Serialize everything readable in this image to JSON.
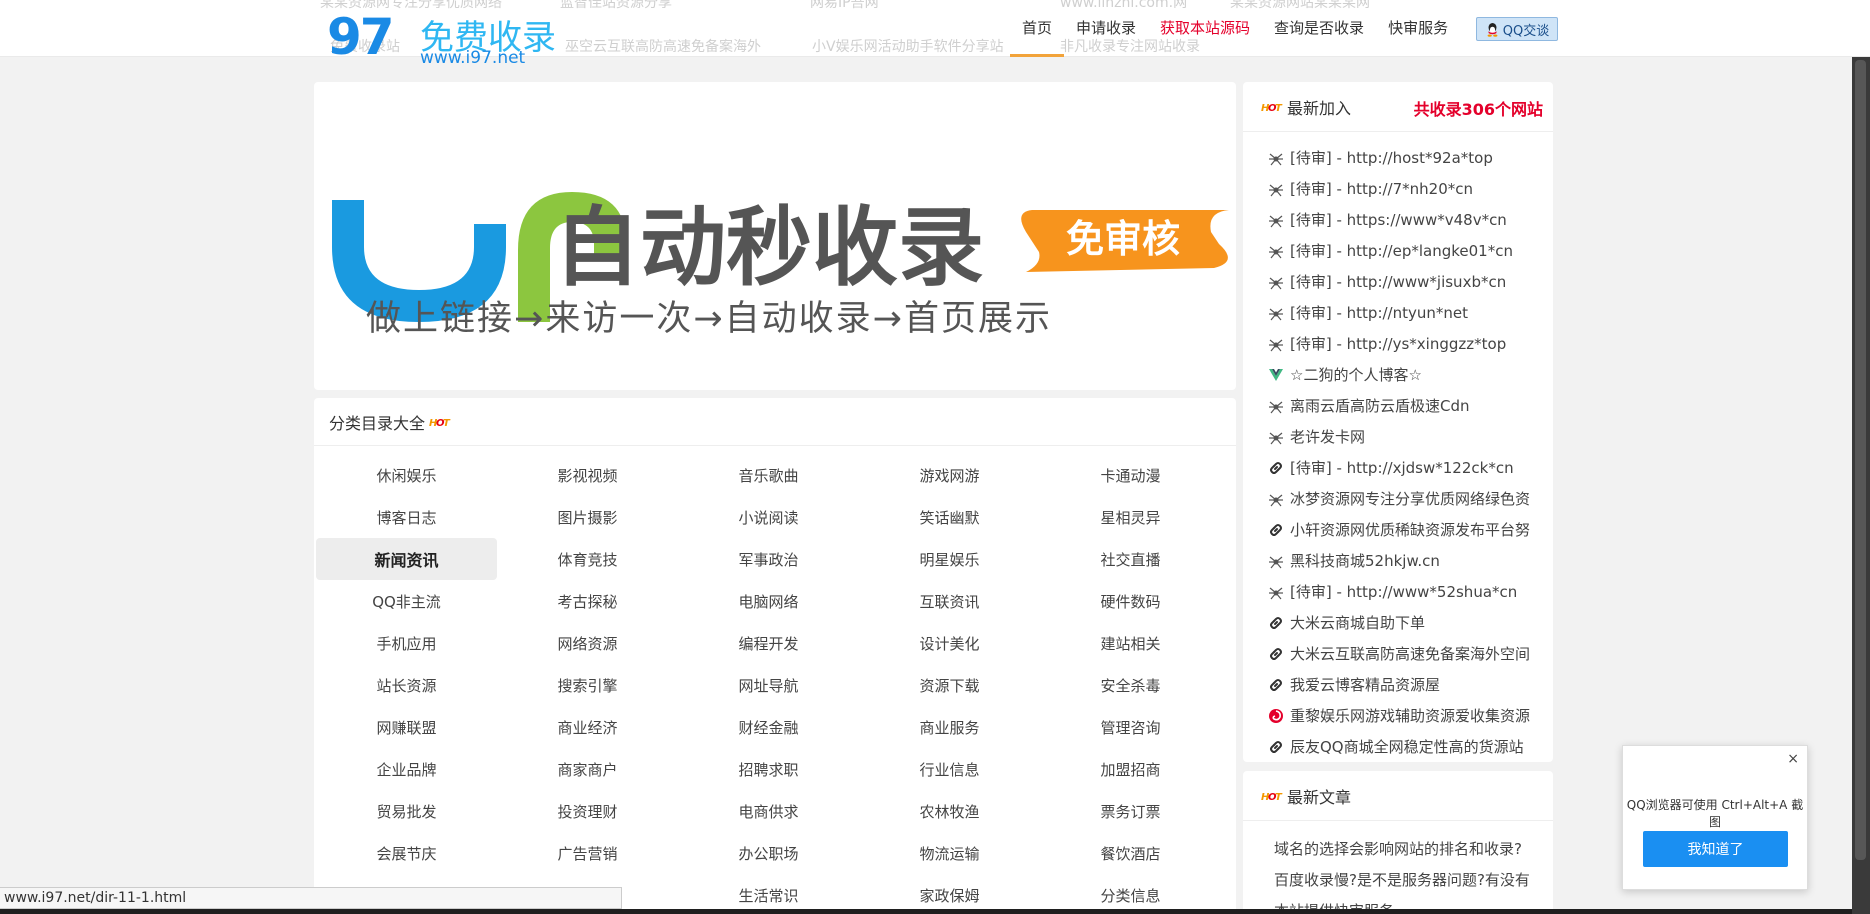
{
  "header": {
    "ghost_texts": [
      "某某资源网专注分享优质网络",
      "蓝智佳站资源分享",
      "网易IP吾网",
      "www.linzhi.com.网",
      "某某资源网站某某某网",
      "免费收录站",
      "巫空云互联高防高速免备案海外",
      "小V娱乐网活动助手软件分享站",
      "非凡收录专注网站收录"
    ],
    "logo": {
      "number": "97",
      "name": "免费收录",
      "url": "www.i97.net"
    },
    "nav": [
      {
        "label": "首页",
        "active": true,
        "highlight": false
      },
      {
        "label": "申请收录",
        "active": false,
        "highlight": false
      },
      {
        "label": "获取本站源码",
        "active": false,
        "highlight": true
      },
      {
        "label": "查询是否收录",
        "active": false,
        "highlight": false
      },
      {
        "label": "快审服务",
        "active": false,
        "highlight": false
      }
    ],
    "qq_button": "QQ交谈"
  },
  "banner": {
    "title": "自动秒收录",
    "badge": "免审核",
    "slogan": "做上链接→来访一次→自动收录→首页展示"
  },
  "categories": {
    "title": "分类目录大全",
    "hot_label": "HOT",
    "active_index": 10,
    "items": [
      "休闲娱乐",
      "影视视频",
      "音乐歌曲",
      "游戏网游",
      "卡通动漫",
      "博客日志",
      "图片摄影",
      "小说阅读",
      "笑话幽默",
      "星相灵异",
      "新闻资讯",
      "体育竞技",
      "军事政治",
      "明星娱乐",
      "社交直播",
      "QQ非主流",
      "考古探秘",
      "电脑网络",
      "互联资讯",
      "硬件数码",
      "手机应用",
      "网络资源",
      "编程开发",
      "设计美化",
      "建站相关",
      "站长资源",
      "搜索引擎",
      "网址导航",
      "资源下载",
      "安全杀毒",
      "网赚联盟",
      "商业经济",
      "财经金融",
      "商业服务",
      "管理咨询",
      "企业品牌",
      "商家商户",
      "招聘求职",
      "行业信息",
      "加盟招商",
      "贸易批发",
      "投资理财",
      "电商供求",
      "农林牧渔",
      "票务订票",
      "会展节庆",
      "广告营销",
      "办公职场",
      "物流运输",
      "餐饮酒店",
      "",
      "",
      "生活常识",
      "家政保姆",
      "分类信息"
    ]
  },
  "latest": {
    "title": "最新加入",
    "count_text": "共收录306个网站",
    "items": [
      {
        "text": "[待审] - http://host*92a*top",
        "icon": "spider"
      },
      {
        "text": "[待审] - http://7*nh20*cn",
        "icon": "spider"
      },
      {
        "text": "[待审] - https://www*v48v*cn",
        "icon": "spider"
      },
      {
        "text": "[待审] - http://ep*langke01*cn",
        "icon": "spider"
      },
      {
        "text": "[待审] - http://www*jisuxb*cn",
        "icon": "spider"
      },
      {
        "text": "[待审] - http://ntyun*net",
        "icon": "spider"
      },
      {
        "text": "[待审] - http://ys*xinggzz*top",
        "icon": "spider"
      },
      {
        "text": "☆二狗的个人博客☆",
        "icon": "vue"
      },
      {
        "text": "离雨云盾高防云盾极速Cdn",
        "icon": "spider"
      },
      {
        "text": "老许发卡网",
        "icon": "spider"
      },
      {
        "text": "[待审] - http://xjdsw*122ck*cn",
        "icon": "link"
      },
      {
        "text": "冰梦资源网专注分享优质网络绿色资",
        "icon": "spider"
      },
      {
        "text": "小轩资源网优质稀缺资源发布平台努",
        "icon": "link"
      },
      {
        "text": "黑科技商城52hkjw.cn",
        "icon": "spider"
      },
      {
        "text": "[待审] - http://www*52shua*cn",
        "icon": "spider"
      },
      {
        "text": "大米云商城自助下单",
        "icon": "link"
      },
      {
        "text": "大米云互联高防高速免备案海外空间",
        "icon": "link"
      },
      {
        "text": "我爱云博客精品资源屋",
        "icon": "link"
      },
      {
        "text": "重黎娱乐网游戏辅助资源爱收集资源",
        "icon": "swirl"
      },
      {
        "text": "辰友QQ商城全网稳定性高的货源站",
        "icon": "link"
      }
    ]
  },
  "articles": {
    "title": "最新文章",
    "items": [
      "域名的选择会影响网站的排名和收录?",
      "百度收录慢?是不是服务器问题?有没有",
      "本站提供快审服务"
    ]
  },
  "popup": {
    "close": "×",
    "message": "QQ浏览器可使用 Ctrl+Alt+A 截图",
    "button": "我知道了"
  },
  "status_bar": {
    "url": "www.i97.net/dir-11-1.html"
  },
  "colors": {
    "accent_blue": "#1a8ae5",
    "red": "#e4002b",
    "orange": "#f39800",
    "banner_blue": "#1a9ae0",
    "banner_green": "#8cc63f"
  }
}
